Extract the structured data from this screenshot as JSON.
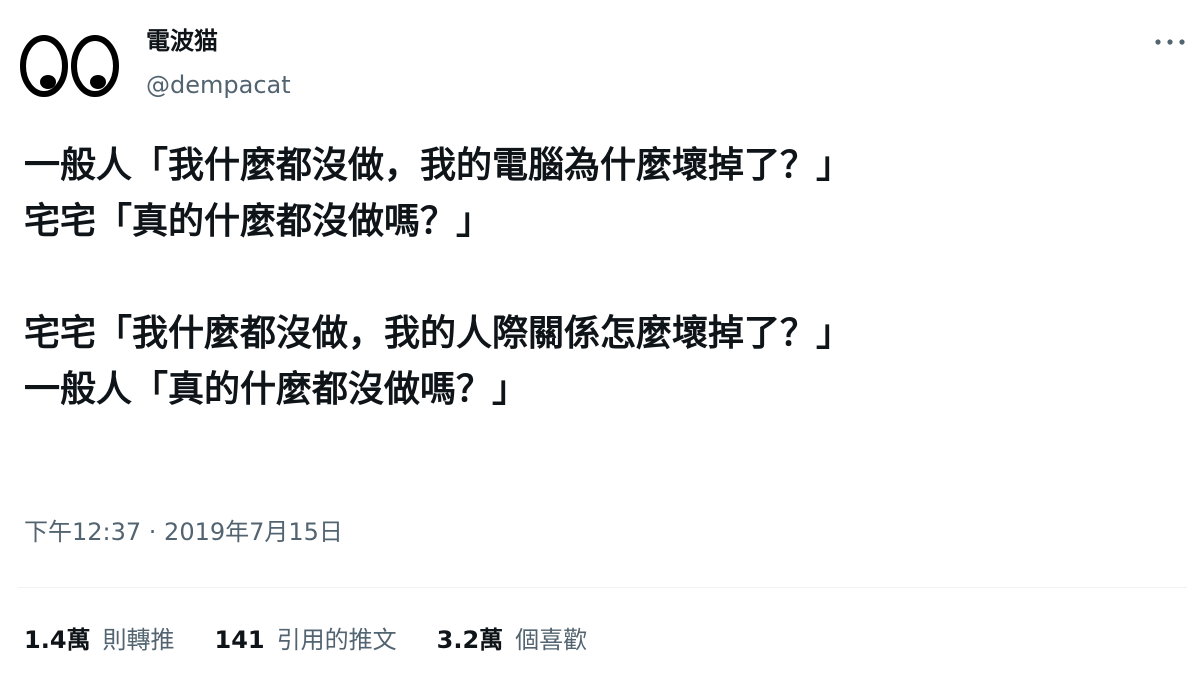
{
  "author": {
    "display_name": "電波猫",
    "handle": "@dempacat"
  },
  "tweet": {
    "lines": [
      "一般人「我什麼都沒做，我的電腦為什麼壞掉了？」",
      "宅宅「真的什麼都沒做嗎？」",
      "宅宅「我什麼都沒做，我的人際關係怎麼壞掉了？」",
      "一般人「真的什麼都沒做嗎？」"
    ],
    "timestamp": "下午12:37 · 2019年7月15日"
  },
  "stats": {
    "retweets": {
      "count": "1.4萬",
      "label": "則轉推"
    },
    "quotes": {
      "count": "141",
      "label": "引用的推文"
    },
    "likes": {
      "count": "3.2萬",
      "label": "個喜歡"
    }
  },
  "icons": {
    "more": "more-horizontal-icon",
    "avatar": "googly-eyes-avatar"
  },
  "colors": {
    "text_primary": "#0f1419",
    "text_secondary": "#536471",
    "divider": "#eff3f4"
  }
}
